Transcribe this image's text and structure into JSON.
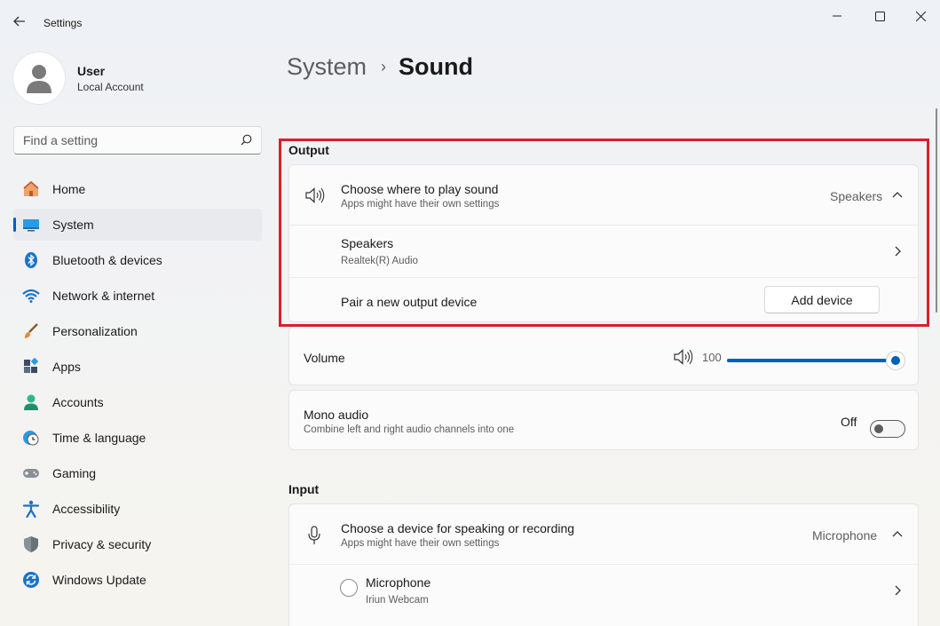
{
  "window": {
    "title": "Settings",
    "controls": {
      "minimize": "minimize-icon",
      "maximize": "maximize-icon",
      "close": "close-icon"
    }
  },
  "profile": {
    "name": "User",
    "account_type": "Local Account"
  },
  "search": {
    "placeholder": "Find a setting"
  },
  "sidebar": {
    "items": [
      {
        "label": "Home",
        "icon": "home-icon"
      },
      {
        "label": "System",
        "icon": "system-icon",
        "active": true
      },
      {
        "label": "Bluetooth & devices",
        "icon": "bluetooth-icon"
      },
      {
        "label": "Network & internet",
        "icon": "wifi-icon"
      },
      {
        "label": "Personalization",
        "icon": "paintbrush-icon"
      },
      {
        "label": "Apps",
        "icon": "apps-icon"
      },
      {
        "label": "Accounts",
        "icon": "accounts-icon"
      },
      {
        "label": "Time & language",
        "icon": "clock-globe-icon"
      },
      {
        "label": "Gaming",
        "icon": "gamepad-icon"
      },
      {
        "label": "Accessibility",
        "icon": "accessibility-icon"
      },
      {
        "label": "Privacy & security",
        "icon": "shield-icon"
      },
      {
        "label": "Windows Update",
        "icon": "update-icon"
      }
    ]
  },
  "breadcrumb": {
    "parent": "System",
    "separator": "›",
    "current": "Sound"
  },
  "output": {
    "section_title": "Output",
    "choose": {
      "title": "Choose where to play sound",
      "subtitle": "Apps might have their own settings",
      "value": "Speakers"
    },
    "device": {
      "title": "Speakers",
      "subtitle": "Realtek(R) Audio"
    },
    "pair": {
      "title": "Pair a new output device",
      "button": "Add device"
    },
    "volume": {
      "title": "Volume",
      "value": "100",
      "level": 1.0
    },
    "mono": {
      "title": "Mono audio",
      "subtitle": "Combine left and right audio channels into one",
      "state": "Off"
    }
  },
  "input": {
    "section_title": "Input",
    "choose": {
      "title": "Choose a device for speaking or recording",
      "subtitle": "Apps might have their own settings",
      "value": "Microphone"
    },
    "device": {
      "title": "Microphone",
      "subtitle": "Iriun Webcam"
    }
  },
  "colors": {
    "accent": "#005fb8",
    "highlight_border": "#d8202c"
  }
}
